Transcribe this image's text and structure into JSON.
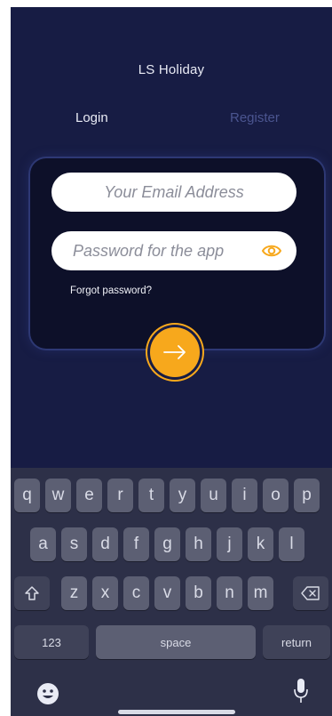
{
  "app": {
    "title": "LS Holiday"
  },
  "tabs": {
    "login": "Login",
    "register": "Register"
  },
  "form": {
    "email_placeholder": "Your Email Address",
    "password_placeholder": "Password for the app",
    "forgot_password": "Forgot password?"
  },
  "icons": {
    "eye": "eye-icon",
    "submit": "arrow-right-icon"
  },
  "colors": {
    "background": "#171c44",
    "accent": "#f7a81c",
    "card": "#0d1029"
  },
  "keyboard": {
    "row1": [
      "q",
      "w",
      "e",
      "r",
      "t",
      "y",
      "u",
      "i",
      "o",
      "p"
    ],
    "row2": [
      "a",
      "s",
      "d",
      "f",
      "g",
      "h",
      "j",
      "k",
      "l"
    ],
    "row3": [
      "z",
      "x",
      "c",
      "v",
      "b",
      "n",
      "m"
    ],
    "numbers_label": "123",
    "space_label": "space",
    "return_label": "return"
  }
}
